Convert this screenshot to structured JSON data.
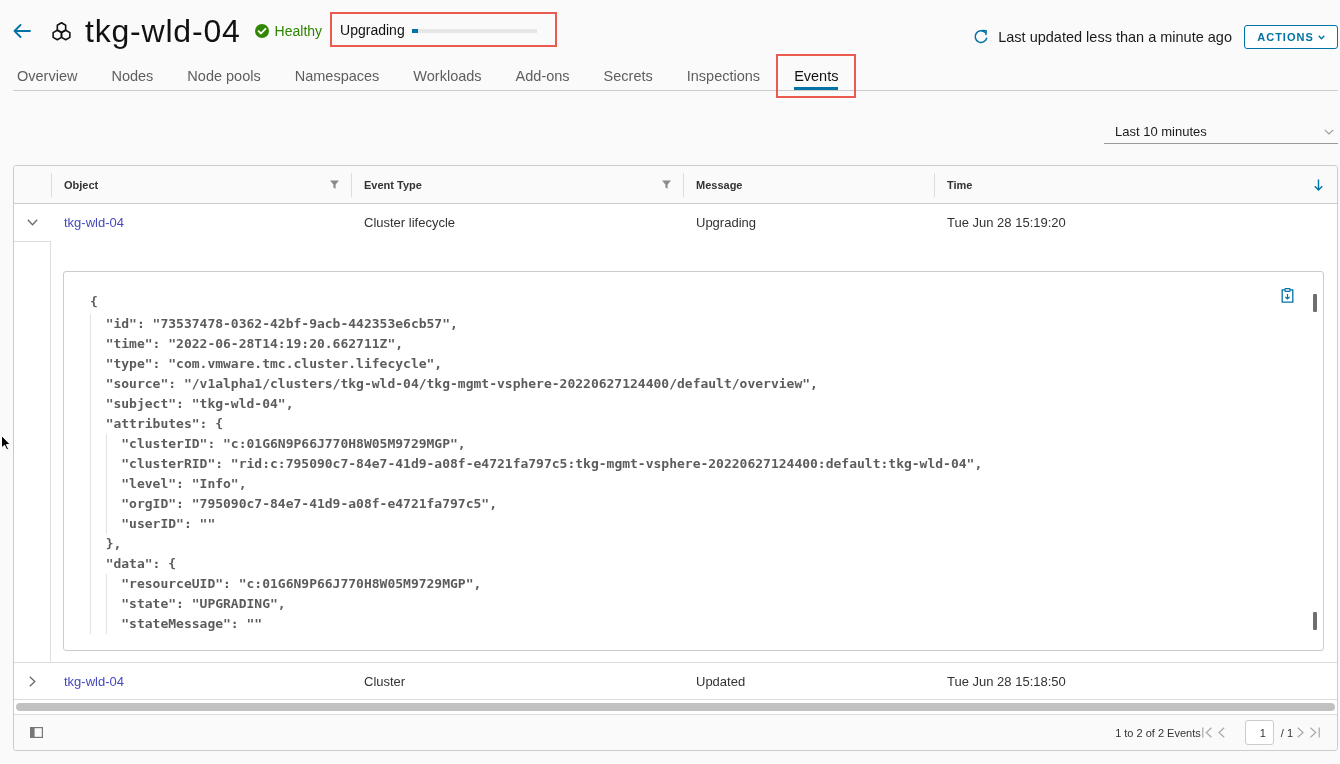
{
  "header": {
    "title": "tkg-wld-04",
    "health": {
      "label": "Healthy"
    },
    "upgrade": {
      "label": "Upgrading",
      "level": 0.05,
      "highlighted": true
    },
    "last_updated": "Last updated less than a minute ago",
    "actions_button": "ACTIONS"
  },
  "tabs": [
    {
      "label": "Overview",
      "selected": false,
      "highlighted": false
    },
    {
      "label": "Nodes",
      "selected": false,
      "highlighted": false
    },
    {
      "label": "Node pools",
      "selected": false,
      "highlighted": false
    },
    {
      "label": "Namespaces",
      "selected": false,
      "highlighted": false
    },
    {
      "label": "Workloads",
      "selected": false,
      "highlighted": false
    },
    {
      "label": "Add-ons",
      "selected": false,
      "highlighted": false
    },
    {
      "label": "Secrets",
      "selected": false,
      "highlighted": false
    },
    {
      "label": "Inspections",
      "selected": false,
      "highlighted": false
    },
    {
      "label": "Events",
      "selected": true,
      "highlighted": true
    }
  ],
  "time_range": {
    "value": "Last 10 minutes"
  },
  "table": {
    "columns": [
      {
        "label": "Object",
        "filterable": true,
        "sorted": false
      },
      {
        "label": "Event Type",
        "filterable": true,
        "sorted": false
      },
      {
        "label": "Message",
        "filterable": false,
        "sorted": false
      },
      {
        "label": "Time",
        "filterable": false,
        "sorted": true
      }
    ],
    "rows": [
      {
        "object": "tkg-wld-04",
        "event_type": "Cluster lifecycle",
        "message": "Upgrading",
        "time": "Tue Jun 28 15:19:20",
        "expanded": true,
        "detail": {
          "lines": [
            {
              "text": "{",
              "children": [
                {
                  "text": "\"id\": \"73537478-0362-42bf-9acb-442353e6cb57\","
                },
                {
                  "text": "\"time\": \"2022-06-28T14:19:20.662711Z\","
                },
                {
                  "text": "\"type\": \"com.vmware.tmc.cluster.lifecycle\","
                },
                {
                  "text": "\"source\": \"/v1alpha1/clusters/tkg-wld-04/tkg-mgmt-vsphere-20220627124400/default/overview\","
                },
                {
                  "text": "\"subject\": \"tkg-wld-04\","
                },
                {
                  "text": "\"attributes\": {",
                  "children": [
                    {
                      "text": "\"clusterID\": \"c:01G6N9P66J770H8W05M9729MGP\","
                    },
                    {
                      "text": "\"clusterRID\": \"rid:c:795090c7-84e7-41d9-a08f-e4721fa797c5:tkg-mgmt-vsphere-20220627124400:default:tkg-wld-04\","
                    },
                    {
                      "text": "\"level\": \"Info\","
                    },
                    {
                      "text": "\"orgID\": \"795090c7-84e7-41d9-a08f-e4721fa797c5\","
                    },
                    {
                      "text": "\"userID\": \"\""
                    }
                  ]
                },
                {
                  "text": "},"
                },
                {
                  "text": "\"data\": {",
                  "children": [
                    {
                      "text": "\"resourceUID\": \"c:01G6N9P66J770H8W05M9729MGP\","
                    },
                    {
                      "text": "\"state\": \"UPGRADING\","
                    },
                    {
                      "text": "\"stateMessage\": \"\""
                    }
                  ]
                }
              ]
            }
          ]
        }
      },
      {
        "object": "tkg-wld-04",
        "event_type": "Cluster",
        "message": "Updated",
        "time": "Tue Jun 28 15:18:50",
        "expanded": false
      }
    ]
  },
  "footer": {
    "summary": "1 to 2 of 2 Events",
    "page": "1",
    "page_total": "/ 1"
  }
}
